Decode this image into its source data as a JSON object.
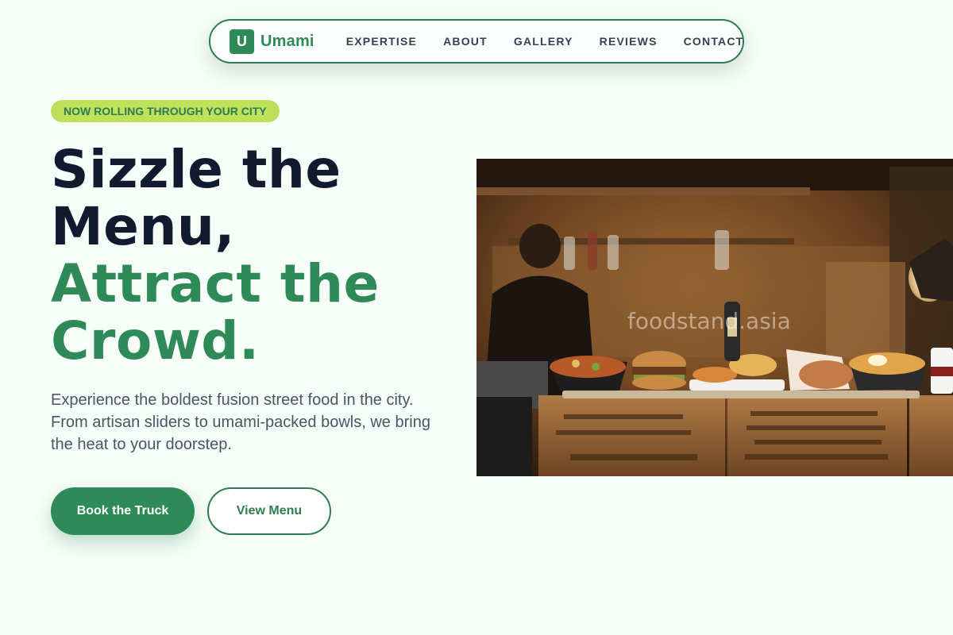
{
  "brand": {
    "logo_letter": "U",
    "name": "Umami"
  },
  "nav": {
    "links": [
      {
        "label": "EXPERTISE"
      },
      {
        "label": "ABOUT"
      },
      {
        "label": "GALLERY"
      },
      {
        "label": "REVIEWS"
      },
      {
        "label": "CONTACT"
      }
    ]
  },
  "hero": {
    "badge": "NOW ROLLING THROUGH YOUR CITY",
    "headline": {
      "line1": "Sizzle the",
      "line2": "Menu,",
      "line3": "Attract the",
      "line4": "Crowd."
    },
    "lead": "Experience the boldest fusion street food in the city. From artisan sliders to umami-packed bowls, we bring the heat to your doorstep.",
    "primary_cta": "Book the Truck",
    "secondary_cta": "View Menu",
    "image_watermark": "foodstand.asia"
  },
  "colors": {
    "accent": "#2e8b57",
    "accent_dark": "#2e7d52",
    "badge_bg": "#bde159",
    "heading_dark": "#111a2e",
    "page_bg": "#f6fcf7"
  }
}
